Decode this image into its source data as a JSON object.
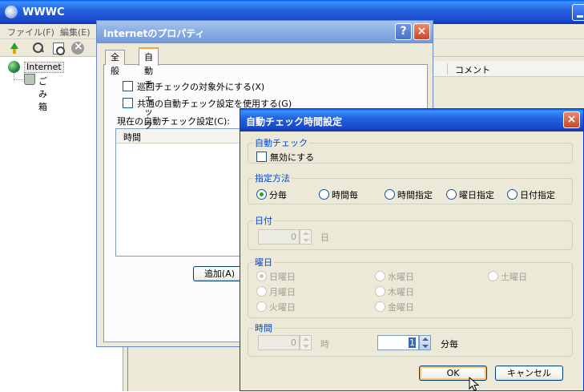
{
  "app": {
    "title": "WWWC",
    "menu": [
      "ファイル(F)",
      "編集(E)"
    ],
    "tree": {
      "root": "Internet",
      "trash": "ごみ箱"
    },
    "list_columns": {
      "comment": "コメント"
    }
  },
  "props_dialog": {
    "title": "Internetのプロパティ",
    "help": "?",
    "close": "×",
    "tabs": [
      "全般",
      "自動チェック"
    ],
    "active_tab": "自動チェック",
    "checkbox_exclude": "巡回チェックの対象外にする(X)",
    "checkbox_common": "共通の自動チェック設定を使用する(G)",
    "current_settings_label": "現在の自動チェック設定(C):",
    "list_column_time": "時間",
    "add_button": "追加(A)"
  },
  "time_dialog": {
    "title": "自動チェック時間設定",
    "close": "×",
    "group_autocheck": "自動チェック",
    "disable_label": "無効にする",
    "group_method": "指定方法",
    "methods": [
      "分毎",
      "時間毎",
      "時間指定",
      "曜日指定",
      "日付指定"
    ],
    "selected_method": "分毎",
    "group_date": "日付",
    "date_value": "0",
    "date_unit": "日",
    "group_weekday": "曜日",
    "weekdays": [
      "日曜日",
      "月曜日",
      "火曜日",
      "水曜日",
      "木曜日",
      "金曜日",
      "土曜日"
    ],
    "selected_weekday": "日曜日",
    "group_time": "時間",
    "hour_value": "0",
    "hour_unit": "時",
    "minute_value": "1",
    "minute_unit": "分毎",
    "ok": "OK",
    "cancel": "キャンセル"
  }
}
